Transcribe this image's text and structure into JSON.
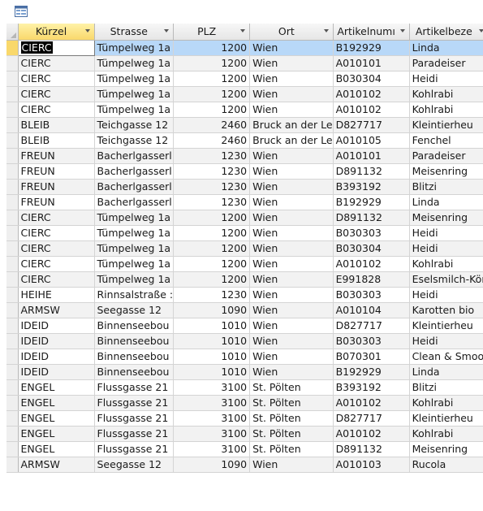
{
  "columns": [
    {
      "label": "Kürzel",
      "name": "col-kuerzel",
      "w": 113
    },
    {
      "label": "Strasse",
      "name": "col-strasse",
      "w": 94
    },
    {
      "label": "PLZ",
      "name": "col-plz",
      "w": 94
    },
    {
      "label": "Ort",
      "name": "col-ort",
      "w": 94
    },
    {
      "label": "Artikelnumı",
      "name": "col-artikelnummer",
      "w": 94
    },
    {
      "label": "Artikelbeze",
      "name": "col-artikelbezeichnung",
      "w": 94
    }
  ],
  "rows": [
    [
      "CIERC",
      "Tümpelweg 1a",
      "1200",
      "Wien",
      "B192929",
      "Linda"
    ],
    [
      "CIERC",
      "Tümpelweg 1a",
      "1200",
      "Wien",
      "A010101",
      "Paradeiser"
    ],
    [
      "CIERC",
      "Tümpelweg 1a",
      "1200",
      "Wien",
      "B030304",
      "Heidi"
    ],
    [
      "CIERC",
      "Tümpelweg 1a",
      "1200",
      "Wien",
      "A010102",
      "Kohlrabi"
    ],
    [
      "CIERC",
      "Tümpelweg 1a",
      "1200",
      "Wien",
      "A010102",
      "Kohlrabi"
    ],
    [
      "BLEIB",
      "Teichgasse 12",
      "2460",
      "Bruck an der Le",
      "D827717",
      "Kleintierheu"
    ],
    [
      "BLEIB",
      "Teichgasse 12",
      "2460",
      "Bruck an der Le",
      "A010105",
      "Fenchel"
    ],
    [
      "FREUN",
      "Bacherlgasserl",
      "1230",
      "Wien",
      "A010101",
      "Paradeiser"
    ],
    [
      "FREUN",
      "Bacherlgasserl",
      "1230",
      "Wien",
      "D891132",
      "Meisenring"
    ],
    [
      "FREUN",
      "Bacherlgasserl",
      "1230",
      "Wien",
      "B393192",
      "Blitzi"
    ],
    [
      "FREUN",
      "Bacherlgasserl",
      "1230",
      "Wien",
      "B192929",
      "Linda"
    ],
    [
      "CIERC",
      "Tümpelweg 1a",
      "1200",
      "Wien",
      "D891132",
      "Meisenring"
    ],
    [
      "CIERC",
      "Tümpelweg 1a",
      "1200",
      "Wien",
      "B030303",
      "Heidi"
    ],
    [
      "CIERC",
      "Tümpelweg 1a",
      "1200",
      "Wien",
      "B030304",
      "Heidi"
    ],
    [
      "CIERC",
      "Tümpelweg 1a",
      "1200",
      "Wien",
      "A010102",
      "Kohlrabi"
    ],
    [
      "CIERC",
      "Tümpelweg 1a",
      "1200",
      "Wien",
      "E991828",
      "Eselsmilch-Kör"
    ],
    [
      "HEIHE",
      "Rinnsalstraße :",
      "1230",
      "Wien",
      "B030303",
      "Heidi"
    ],
    [
      "ARMSW",
      "Seegasse 12",
      "1090",
      "Wien",
      "A010104",
      "Karotten bio"
    ],
    [
      "IDEID",
      "Binnenseebou",
      "1010",
      "Wien",
      "D827717",
      "Kleintierheu"
    ],
    [
      "IDEID",
      "Binnenseebou",
      "1010",
      "Wien",
      "B030303",
      "Heidi"
    ],
    [
      "IDEID",
      "Binnenseebou",
      "1010",
      "Wien",
      "B070301",
      "Clean & Smoot"
    ],
    [
      "IDEID",
      "Binnenseebou",
      "1010",
      "Wien",
      "B192929",
      "Linda"
    ],
    [
      "ENGEL",
      "Flussgasse 21",
      "3100",
      "St. Pölten",
      "B393192",
      "Blitzi"
    ],
    [
      "ENGEL",
      "Flussgasse 21",
      "3100",
      "St. Pölten",
      "A010102",
      "Kohlrabi"
    ],
    [
      "ENGEL",
      "Flussgasse 21",
      "3100",
      "St. Pölten",
      "D827717",
      "Kleintierheu"
    ],
    [
      "ENGEL",
      "Flussgasse 21",
      "3100",
      "St. Pölten",
      "A010102",
      "Kohlrabi"
    ],
    [
      "ENGEL",
      "Flussgasse 21",
      "3100",
      "St. Pölten",
      "D891132",
      "Meisenring"
    ],
    [
      "ARMSW",
      "Seegasse 12",
      "1090",
      "Wien",
      "A010103",
      "Rucola"
    ]
  ],
  "current_row": 0,
  "colors": {
    "current_row": "#b8d8f8",
    "selected_header": "#f9d86b"
  }
}
